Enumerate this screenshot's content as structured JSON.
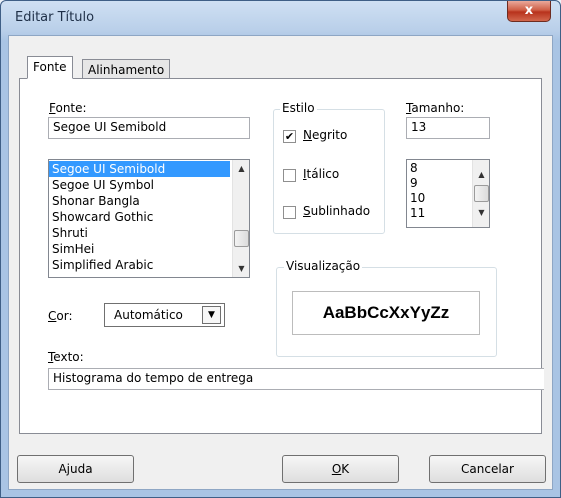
{
  "window": {
    "title": "Editar Título",
    "close_glyph": "x"
  },
  "tabs": [
    {
      "label": "Fonte"
    },
    {
      "label": "Alinhamento"
    }
  ],
  "font": {
    "label_first": "F",
    "label_rest": "onte:",
    "value": "Segoe UI Semibold",
    "list": [
      "Segoe UI Semibold",
      "Segoe UI Symbol",
      "Shonar Bangla",
      "Showcard Gothic",
      "Shruti",
      "SimHei",
      "Simplified Arabic"
    ]
  },
  "style": {
    "group_label": "Estilo",
    "bold": {
      "first": "N",
      "rest": "egrito",
      "checked": true
    },
    "italic": {
      "first": "I",
      "rest": "tálico",
      "checked": false
    },
    "underline": {
      "first": "S",
      "rest": "ublinhado",
      "checked": false
    },
    "check_glyph": "✔"
  },
  "size": {
    "label_first": "T",
    "label_rest": "amanho:",
    "value": "13",
    "list": [
      "8",
      "9",
      "10",
      "11"
    ]
  },
  "color": {
    "label_first": "C",
    "label_rest": "or:",
    "value": "Automático"
  },
  "preview": {
    "group_label": "Visualização",
    "sample": "AaBbCcXxYyZz"
  },
  "text": {
    "label_first": "T",
    "label_rest": "exto:",
    "value": "Histograma do tempo de entrega"
  },
  "buttons": {
    "help": "Ajuda",
    "ok_first": "O",
    "ok_rest": "K",
    "cancel": "Cancelar"
  },
  "icons": {
    "scroll_up": "▲",
    "scroll_down": "▼",
    "dropdown": "▼"
  }
}
